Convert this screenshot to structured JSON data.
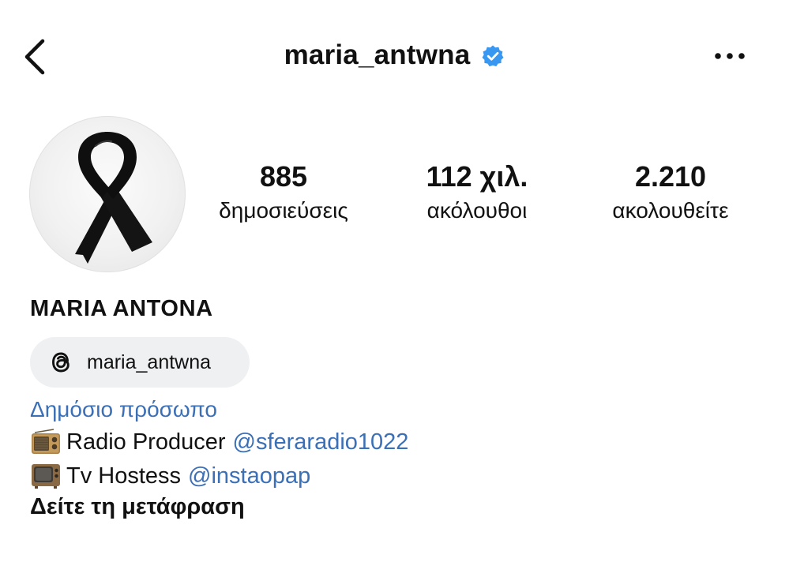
{
  "header": {
    "username": "maria_antwna",
    "verified": true,
    "back_icon": "chevron-left-icon",
    "more_icon": "more-horizontal-icon"
  },
  "profile": {
    "avatar_description": "black-ribbon",
    "stats": {
      "posts": {
        "value": "885",
        "label": "δημοσιεύσεις"
      },
      "followers": {
        "value": "112 χιλ.",
        "label": "ακόλουθοι"
      },
      "following": {
        "value": "2.210",
        "label": "ακολουθείτε"
      }
    },
    "display_name": "MARIA ANTONA",
    "threads": {
      "icon": "threads-icon",
      "handle": "maria_antwna"
    },
    "category": "Δημόσιο πρόσωπο",
    "bio": [
      {
        "icon": "radio-emoji-icon",
        "text": "Radio Producer",
        "mention": "@sferaradio1022"
      },
      {
        "icon": "television-emoji-icon",
        "text": "Tv Hostess",
        "mention": "@instaopap"
      }
    ],
    "see_translation": "Δείτε τη μετάφραση"
  },
  "colors": {
    "link": "#3b6fb6",
    "verified": "#3897f0",
    "pill_background": "#eff0f2",
    "text": "#111111"
  }
}
